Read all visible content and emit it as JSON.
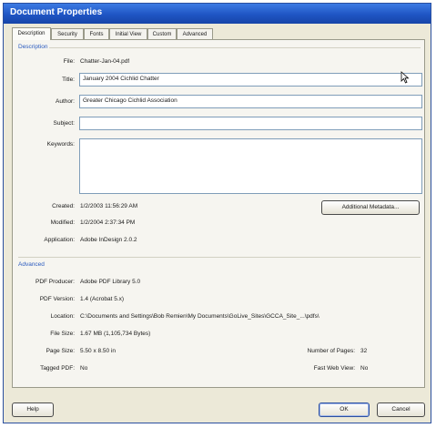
{
  "window": {
    "title": "Document Properties"
  },
  "tabs": [
    "Description",
    "Security",
    "Fonts",
    "Initial View",
    "Custom",
    "Advanced"
  ],
  "description": {
    "section_title": "Description",
    "file_label": "File:",
    "file_value": "Chatter-Jan-04.pdf",
    "title_label": "Title:",
    "title_value": "January 2004 Cichlid Chatter",
    "author_label": "Author:",
    "author_value": "Greater Chicago Cichlid Association",
    "subject_label": "Subject:",
    "subject_value": "",
    "keywords_label": "Keywords:",
    "keywords_value": "",
    "created_label": "Created:",
    "created_value": "1/2/2003 11:56:29 AM",
    "modified_label": "Modified:",
    "modified_value": "1/2/2004 2:37:34 PM",
    "application_label": "Application:",
    "application_value": "Adobe InDesign 2.0.2",
    "metadata_button": "Additional Metadata..."
  },
  "advanced": {
    "section_title": "Advanced",
    "pdf_producer_label": "PDF Producer:",
    "pdf_producer_value": "Adobe PDF Library 5.0",
    "pdf_version_label": "PDF Version:",
    "pdf_version_value": "1.4 (Acrobat 5.x)",
    "location_label": "Location:",
    "location_value": "C:\\Documents and Settings\\Bob Remien\\My Documents\\GoLive_Sites\\GCCA_Site_...\\pdfs\\",
    "file_size_label": "File Size:",
    "file_size_value": "1.67 MB (1,105,734 Bytes)",
    "page_size_label": "Page Size:",
    "page_size_value": "5.50 x 8.50 in",
    "tagged_pdf_label": "Tagged PDF:",
    "tagged_pdf_value": "No",
    "num_pages_label": "Number of Pages:",
    "num_pages_value": "32",
    "fast_web_label": "Fast Web View:",
    "fast_web_value": "No"
  },
  "footer": {
    "help": "Help",
    "ok": "OK",
    "cancel": "Cancel"
  },
  "icons": {
    "cursor": "mouse-pointer-icon"
  }
}
